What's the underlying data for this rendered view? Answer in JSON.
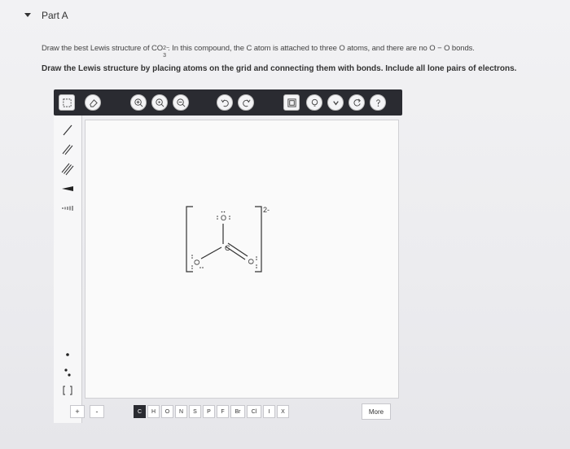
{
  "part": {
    "title": "Part A"
  },
  "instructions": {
    "line1_before": "Draw the best Lewis structure of CO",
    "line1_sup": "2−",
    "line1_sub": "3",
    "line1_after": ". In this compound, the C atom is attached to three O atoms, and there are no O − O bonds.",
    "line2": "Draw the Lewis structure by placing atoms on the grid and connecting them with bonds. Include all lone pairs of electrons."
  },
  "toolbar": {
    "buttons": [
      {
        "name": "select-icon"
      },
      {
        "name": "eraser-icon"
      },
      {
        "name": "zoom-reset-icon"
      },
      {
        "name": "zoom-in-icon"
      },
      {
        "name": "zoom-out-icon"
      },
      {
        "name": "undo-icon"
      },
      {
        "name": "redo-icon"
      },
      {
        "name": "templates-icon"
      },
      {
        "name": "hint-icon"
      },
      {
        "name": "dropdown-icon"
      },
      {
        "name": "reset-icon"
      },
      {
        "name": "help-icon"
      }
    ]
  },
  "left_tools": {
    "bonds": [
      "single-bond",
      "double-bond",
      "triple-bond",
      "wedge-bond",
      "hash-bond"
    ],
    "electron_tools": [
      "lone-electron",
      "lone-pair",
      "bracket"
    ]
  },
  "molecule": {
    "atoms": [
      {
        "id": "O_top",
        "label": "O"
      },
      {
        "id": "C_center",
        "label": "C"
      },
      {
        "id": "O_left",
        "label": "O"
      },
      {
        "id": "O_right",
        "label": "O"
      }
    ],
    "charge": "2-"
  },
  "bottom": {
    "plus": "+",
    "minus": "-",
    "elements": [
      "C",
      "H",
      "O",
      "N",
      "S",
      "P",
      "F",
      "Br",
      "Cl",
      "I",
      "X"
    ],
    "active_element": "C",
    "more": "More"
  },
  "colors": {
    "toolbar_bg": "#2a2b31",
    "canvas_bg": "#fafafa"
  }
}
